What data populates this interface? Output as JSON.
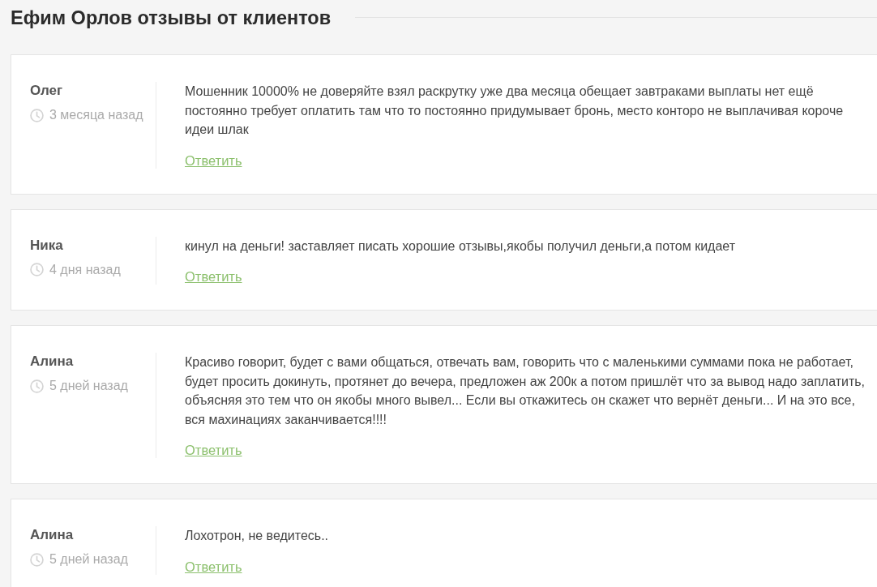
{
  "page": {
    "title": "Ефим Орлов отзывы от клиентов"
  },
  "reviews": [
    {
      "author": "Олег",
      "time": "3 месяца назад",
      "text": "Мошенник 10000% не доверяйте взял раскрутку уже два месяца обещает завтраками выплаты нет ещё постоянно требует оплатить там что то постоянно придумывает бронь, место конторо не выплачивая короче идеи шлак",
      "reply_link": "Ответить"
    },
    {
      "author": "Ника",
      "time": "4 дня назад",
      "text": "кинул на деньги! заставляет писать хорошие отзывы,якобы получил деньги,а потом кидает",
      "reply_link": "Ответить"
    },
    {
      "author": "Алина",
      "time": "5 дней назад",
      "text": "Красиво говорит, будет с вами общаться, отвечать вам, говорить что с маленькими суммами пока не работает, будет просить докинуть, протянет до вечера, предложен аж 200к а потом пришлёт что за вывод надо заплатить, объясняя это тем что он якобы много вывел... Если вы откажитесь он скажет что вернёт деньги... И на это все, вся махинациях заканчивается!!!!",
      "reply_link": "Ответить"
    },
    {
      "author": "Алина",
      "time": "5 дней назад",
      "text": "Лохотрон, не ведитесь..",
      "reply_link": "Ответить"
    }
  ]
}
